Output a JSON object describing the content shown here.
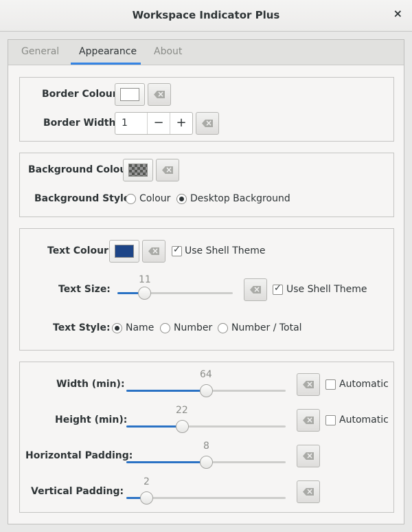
{
  "window": {
    "title": "Workspace Indicator Plus",
    "close_glyph": "×"
  },
  "tabs": [
    {
      "label": "General",
      "active": false
    },
    {
      "label": "Appearance",
      "active": true
    },
    {
      "label": "About",
      "active": false
    }
  ],
  "accent_color": "#3584e4",
  "border": {
    "colour_label": "Border Colour:",
    "colour_value": "#ffffff",
    "width_label": "Border Width:",
    "width_value": "1",
    "minus_glyph": "−",
    "plus_glyph": "+"
  },
  "background": {
    "colour_label": "Background Colour:",
    "colour_value": "transparent",
    "style_label": "Background Style:",
    "style_options": [
      "Colour",
      "Desktop Background"
    ],
    "style_selected": "Desktop Background"
  },
  "text": {
    "colour_label": "Text Colour:",
    "colour_value": "#1d4587",
    "colour_use_shell_theme": {
      "label": "Use Shell Theme",
      "checked": true
    },
    "size_label": "Text Size:",
    "size_value": "11",
    "size_fraction": 0.23,
    "size_use_shell_theme": {
      "label": "Use Shell Theme",
      "checked": true
    },
    "style_label": "Text Style:",
    "style_options": [
      "Name",
      "Number",
      "Number / Total"
    ],
    "style_selected": "Name"
  },
  "dimensions": {
    "width": {
      "label": "Width (min):",
      "value": "64",
      "fraction": 0.5,
      "automatic": {
        "label": "Automatic",
        "checked": false
      }
    },
    "height": {
      "label": "Height (min):",
      "value": "22",
      "fraction": 0.35,
      "automatic": {
        "label": "Automatic",
        "checked": false
      }
    },
    "hpad": {
      "label": "Horizontal Padding:",
      "value": "8",
      "fraction": 0.5
    },
    "vpad": {
      "label": "Vertical Padding:",
      "value": "2",
      "fraction": 0.125
    }
  },
  "icons": {
    "clear": "edit-clear-icon",
    "close": "close-icon"
  }
}
